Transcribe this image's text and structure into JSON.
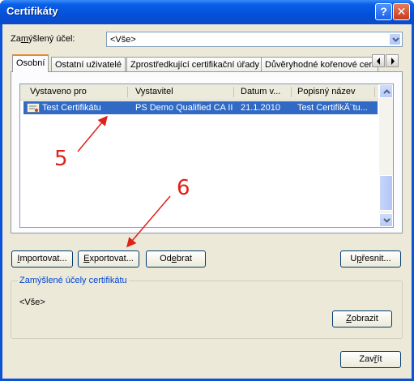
{
  "window": {
    "title": "Certifikáty",
    "help_glyph": "?",
    "close_glyph": "✕"
  },
  "purpose": {
    "label_pre": "Za",
    "label_u": "m",
    "label_post": "ýšlený účel:",
    "value": "<Vše>"
  },
  "tabs": [
    {
      "label": "Osobní"
    },
    {
      "label": "Ostatní uživatelé"
    },
    {
      "label": "Zprostředkující certifikační úřady"
    },
    {
      "label": "Důvěryhodné kořenové cert"
    }
  ],
  "list": {
    "columns": [
      "Vystaveno pro",
      "Vystavitel",
      "Datum v...",
      "Popisný název"
    ],
    "rows": [
      {
        "issued_to": "Test Certifikátu",
        "issuer": "PS Demo Qualified CA II",
        "date": "21.1.2010",
        "friendly": "Test CertifikÃ¨tu..."
      }
    ]
  },
  "buttons": {
    "import": {
      "u": "I",
      "rest": "mportovat..."
    },
    "export": {
      "u": "E",
      "rest": "xportovat..."
    },
    "remove": {
      "pre": "Od",
      "u": "e",
      "rest": "brat"
    },
    "advanced": {
      "pre": "U",
      "u": "p",
      "rest": "řesnit..."
    },
    "view": {
      "u": "Z",
      "rest": "obrazit"
    },
    "close": {
      "pre": "Zav",
      "u": "ř",
      "rest": "ít"
    }
  },
  "group": {
    "title": "Zamýšlené účely certifikátu",
    "value": "<Vše>"
  },
  "annotations": {
    "n5": "5",
    "n6": "6"
  },
  "colors": {
    "titlebar": "#0550d8",
    "selection": "#316ac5",
    "annotation": "#e0201a",
    "face": "#ece9d8"
  },
  "icons": [
    "help-icon",
    "close-icon",
    "chevron-down-icon",
    "chevron-left-icon",
    "chevron-right-icon",
    "certificate-icon",
    "scroll-up-icon",
    "scroll-down-icon"
  ]
}
